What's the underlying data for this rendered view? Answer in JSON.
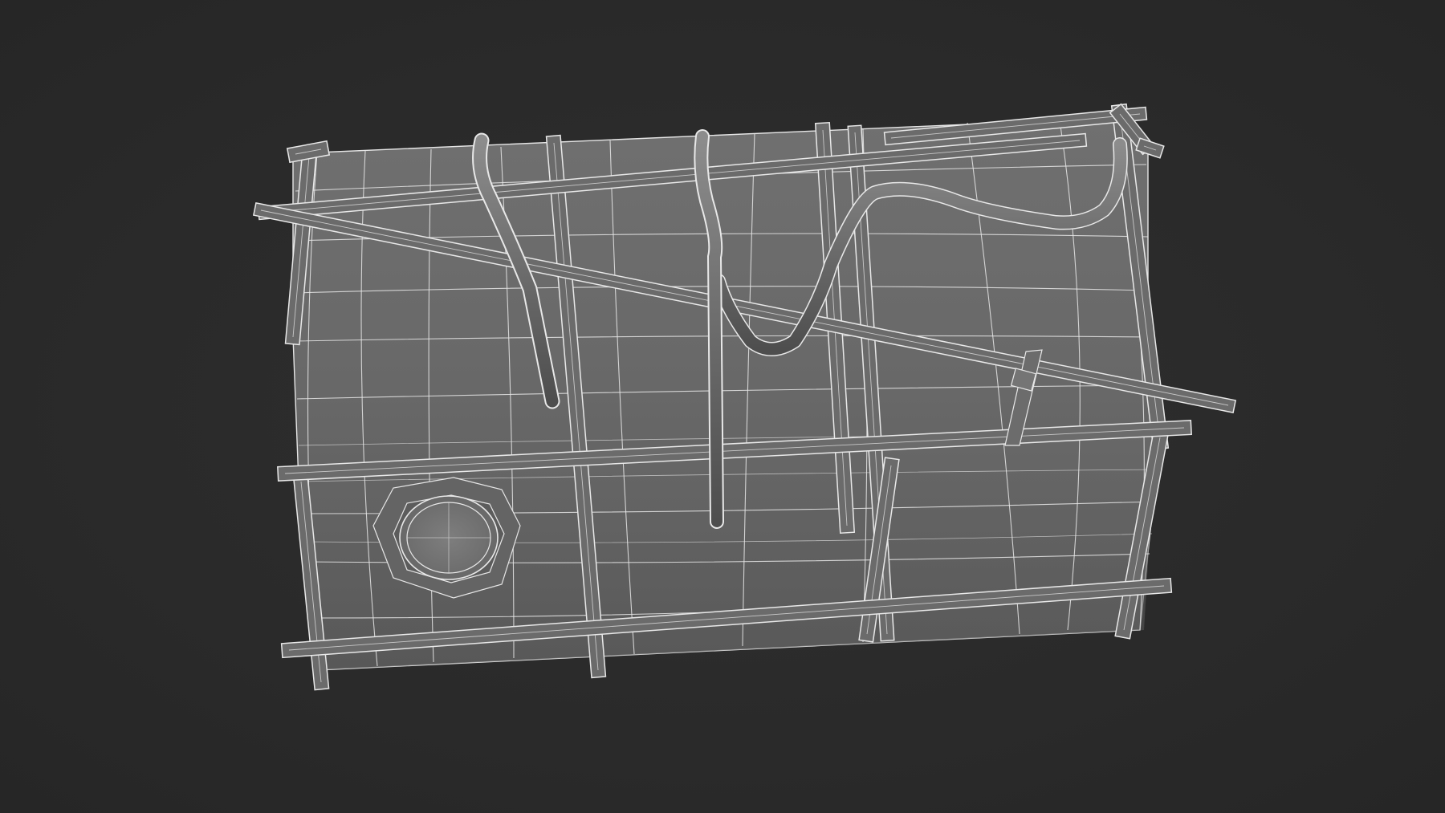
{
  "scene": {
    "background": "#2b2b2b",
    "subject": "wireframe-crate-model",
    "shading": {
      "panel_top": "#6f6f6f",
      "panel_bottom": "#5a5a5a",
      "bar": "#6a6a6a",
      "bar_highlight": "#8a8a8a",
      "wire": "#e8e8e8",
      "porthole": "#7a7a7a"
    }
  }
}
